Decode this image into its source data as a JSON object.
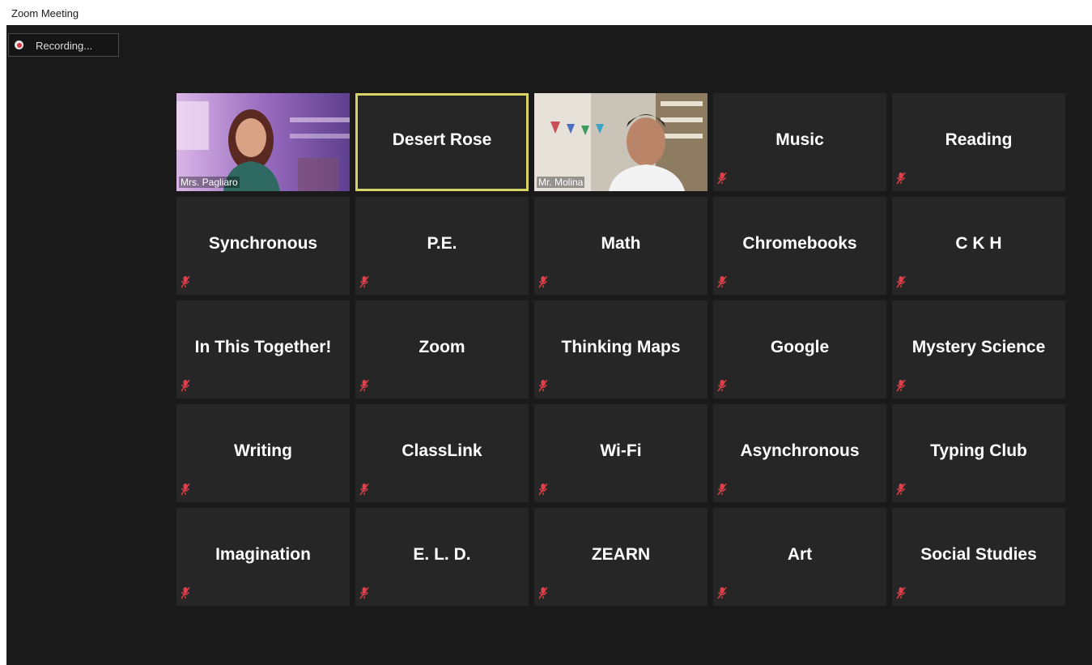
{
  "window": {
    "title": "Zoom Meeting"
  },
  "recording": {
    "label": "Recording..."
  },
  "participants": [
    {
      "name": "Mrs. Pagliaro",
      "type": "video"
    },
    {
      "name": "Desert Rose",
      "type": "name",
      "active": true
    },
    {
      "name": "Mr. Molina",
      "type": "video"
    },
    {
      "name": "Music",
      "type": "name",
      "muted": true
    },
    {
      "name": "Reading",
      "type": "name",
      "muted": true
    },
    {
      "name": "Synchronous",
      "type": "name",
      "muted": true
    },
    {
      "name": "P.E.",
      "type": "name",
      "muted": true
    },
    {
      "name": "Math",
      "type": "name",
      "muted": true
    },
    {
      "name": "Chromebooks",
      "type": "name",
      "muted": true
    },
    {
      "name": "C K H",
      "type": "name",
      "muted": true
    },
    {
      "name": "In This Together!",
      "type": "name",
      "muted": true
    },
    {
      "name": "Zoom",
      "type": "name",
      "muted": true
    },
    {
      "name": "Thinking Maps",
      "type": "name",
      "muted": true
    },
    {
      "name": "Google",
      "type": "name",
      "muted": true
    },
    {
      "name": "Mystery Science",
      "type": "name",
      "muted": true
    },
    {
      "name": "Writing",
      "type": "name",
      "muted": true
    },
    {
      "name": "ClassLink",
      "type": "name",
      "muted": true
    },
    {
      "name": "Wi-Fi",
      "type": "name",
      "muted": true
    },
    {
      "name": "Asynchronous",
      "type": "name",
      "muted": true
    },
    {
      "name": "Typing Club",
      "type": "name",
      "muted": true
    },
    {
      "name": "Imagination",
      "type": "name",
      "muted": true
    },
    {
      "name": "E. L. D.",
      "type": "name",
      "muted": true
    },
    {
      "name": "ZEARN",
      "type": "name",
      "muted": true
    },
    {
      "name": "Art",
      "type": "name",
      "muted": true
    },
    {
      "name": "Social Studies",
      "type": "name",
      "muted": true
    }
  ],
  "icons": {
    "muted_mic": "muted-mic-icon",
    "recording": "recording-dot-icon"
  },
  "colors": {
    "active_speaker_border": "#d8d267",
    "muted_icon": "#e0404a",
    "tile_bg": "#262626",
    "window_bg": "#1a1a1a"
  }
}
